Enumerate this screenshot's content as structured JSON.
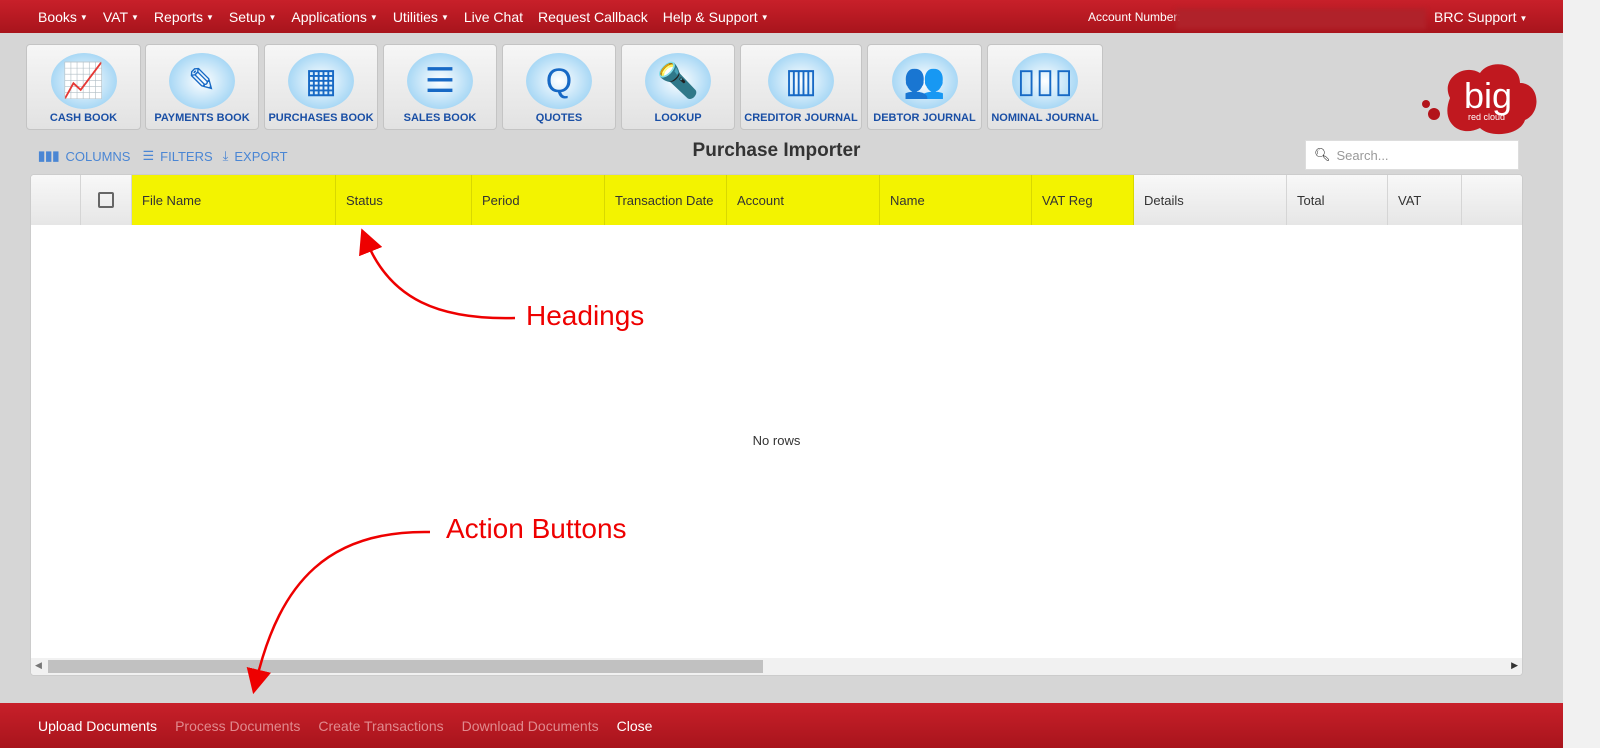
{
  "topnav": {
    "items": [
      {
        "label": "Books",
        "dropdown": true
      },
      {
        "label": "VAT",
        "dropdown": true
      },
      {
        "label": "Reports",
        "dropdown": true
      },
      {
        "label": "Setup",
        "dropdown": true
      },
      {
        "label": "Applications",
        "dropdown": true
      },
      {
        "label": "Utilities",
        "dropdown": true
      },
      {
        "label": "Live Chat",
        "dropdown": false
      },
      {
        "label": "Request Callback",
        "dropdown": false
      },
      {
        "label": "Help & Support",
        "dropdown": true
      }
    ],
    "account_label": "Account Number:",
    "user": "BRC Support"
  },
  "toolbar": [
    {
      "label": "CASH BOOK",
      "icon": "chart-up-icon"
    },
    {
      "label": "PAYMENTS BOOK",
      "icon": "cheque-pen-icon"
    },
    {
      "label": "PURCHASES BOOK",
      "icon": "calculator-icon"
    },
    {
      "label": "SALES BOOK",
      "icon": "notepad-icon"
    },
    {
      "label": "QUOTES",
      "icon": "quote-notepad-icon"
    },
    {
      "label": "LOOKUP",
      "icon": "flashlight-icon"
    },
    {
      "label": "CREDITOR JOURNAL",
      "icon": "document-chart-icon"
    },
    {
      "label": "DEBTOR JOURNAL",
      "icon": "people-icon"
    },
    {
      "label": "NOMINAL JOURNAL",
      "icon": "binders-icon"
    }
  ],
  "logo": {
    "text": "big",
    "subtext": "red cloud"
  },
  "grid_tools": {
    "columns": "COLUMNS",
    "filters": "FILTERS",
    "export": "EXPORT"
  },
  "page_title": "Purchase Importer",
  "search": {
    "placeholder": "Search...",
    "value": ""
  },
  "grid": {
    "columns": [
      "File Name",
      "Status",
      "Period",
      "Transaction Date",
      "Account",
      "Name",
      "VAT Reg",
      "Details",
      "Total",
      "VAT"
    ],
    "highlighted_columns": [
      "File Name",
      "Status",
      "Period",
      "Transaction Date",
      "Account",
      "Name",
      "VAT Reg"
    ],
    "empty_text": "No rows"
  },
  "actions": [
    {
      "label": "Upload Documents",
      "enabled": true
    },
    {
      "label": "Process Documents",
      "enabled": false
    },
    {
      "label": "Create Transactions",
      "enabled": false
    },
    {
      "label": "Download Documents",
      "enabled": false
    },
    {
      "label": "Close",
      "enabled": true
    }
  ],
  "annotations": {
    "headings": "Headings",
    "action_buttons": "Action Buttons"
  },
  "colors": {
    "brand_red": "#c0181f",
    "highlight": "#f3f300",
    "link_blue": "#4a86d4",
    "annotation": "#ee0000"
  }
}
